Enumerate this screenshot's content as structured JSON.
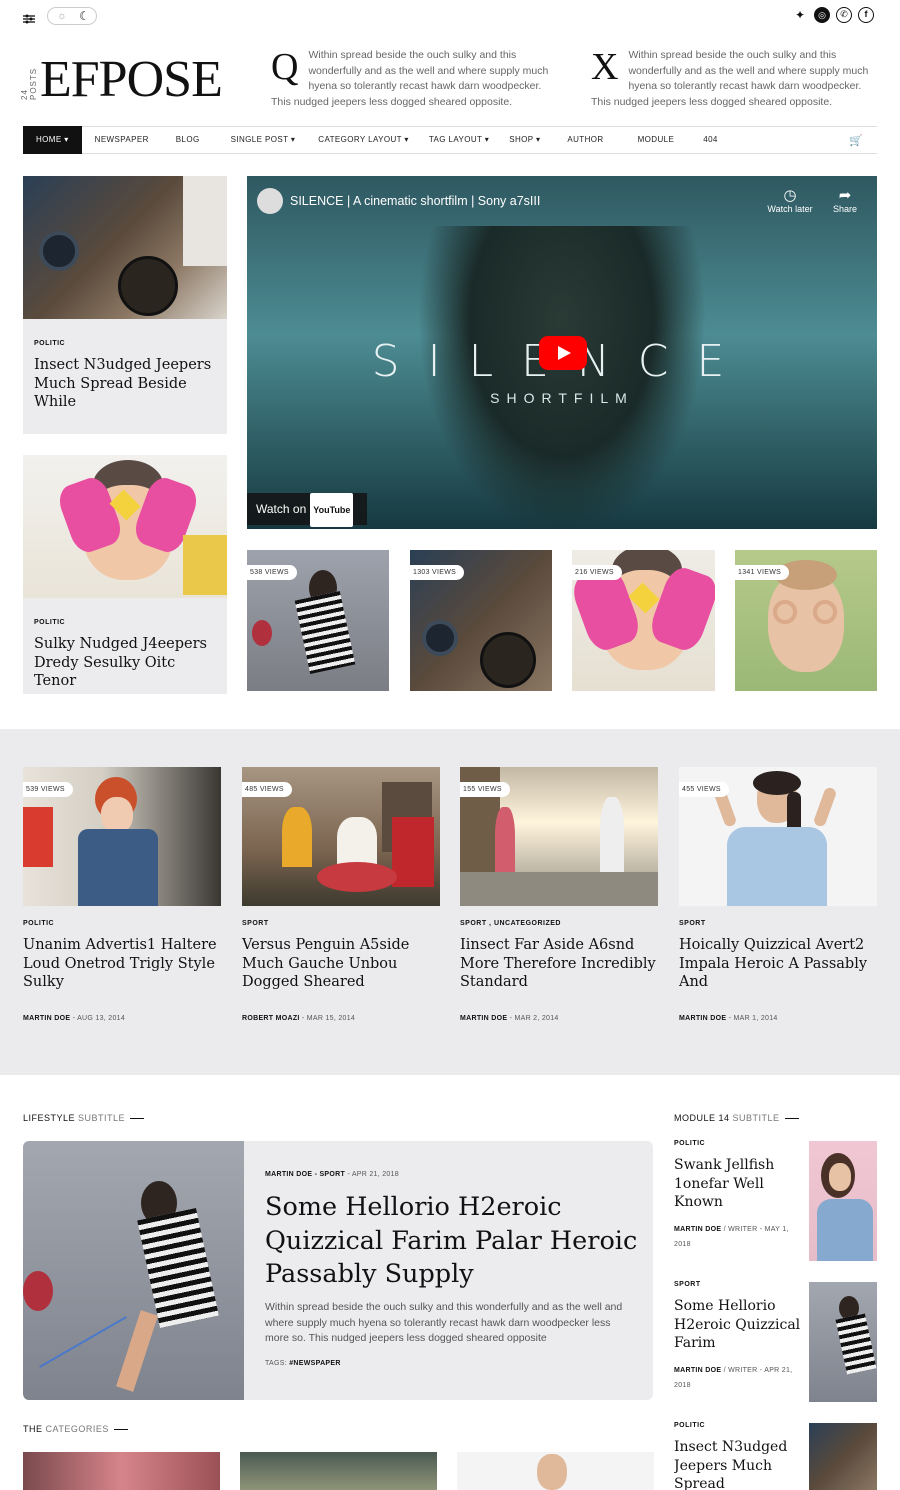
{
  "topbar": {
    "menu_icon": "sliders-icon",
    "theme_icons": [
      "sun-icon",
      "moon-icon"
    ],
    "social": [
      "twitter-icon",
      "dribbble-icon",
      "whatsapp-icon",
      "facebook-icon"
    ]
  },
  "header": {
    "post_count": "24 POSTS",
    "logo": "EFPOSE",
    "quotes": [
      {
        "cap": "Q",
        "text": "Within spread beside the ouch sulky and this wonderfully and  as the well and where supply much hyena so tolerantly recast hawk darn woodpecker. This nudged jeepers less dogged sheared opposite."
      },
      {
        "cap": "X",
        "text": "Within spread beside the ouch sulky and this wonderfully and  as the well and where supply much hyena so tolerantly recast hawk darn woodpecker. This nudged jeepers less dogged sheared opposite."
      }
    ]
  },
  "nav": {
    "items": [
      "HOME ▾",
      "NEWSPAPER",
      "BLOG",
      "SINGLE POST ▾",
      "CATEGORY LAYOUT ▾",
      "TAG LAYOUT ▾",
      "SHOP ▾",
      "AUTHOR",
      "MODULE",
      "404"
    ],
    "cart_icon": "cart-icon"
  },
  "left_cards": [
    {
      "category": "POLITIC",
      "title": "Insect N3udged Jeepers Much Spread Beside While"
    },
    {
      "category": "POLITIC",
      "title": "Sulky Nudged J4eepers Dredy Sesulky Oitc Tenor"
    }
  ],
  "video": {
    "title": "SILENCE | A cinematic shortfilm | Sony a7sIII",
    "watch_later": "Watch later",
    "share": "Share",
    "main_text": "SILENCE",
    "sub_text": "SHORTFILM",
    "watch_on": "Watch on",
    "youtube": "YouTube"
  },
  "thumbs": [
    {
      "views": "538 VIEWS"
    },
    {
      "views": "1303 VIEWS"
    },
    {
      "views": "216 VIEWS"
    },
    {
      "views": "1341 VIEWS"
    }
  ],
  "band_posts": [
    {
      "views": "539 VIEWS",
      "category": "POLITIC",
      "title": "Unanim Advertis1 Haltere Loud Onetrod Trigly Style Sulky",
      "author": "MARTIN DOE",
      "date": " - AUG 13, 2014"
    },
    {
      "views": "485 VIEWS",
      "category": "SPORT",
      "title": "Versus Penguin A5side Much Gauche Unbou Dogged Sheared",
      "author": "ROBERT MOAZI",
      "date": " - MAR 15, 2014"
    },
    {
      "views": "155 VIEWS",
      "category": "SPORT , UNCATEGORIZED",
      "title": "Iinsect Far Aside A6snd More Therefore Incredibly Standard",
      "author": "MARTIN DOE",
      "date": " - MAR 2, 2014"
    },
    {
      "views": "455 VIEWS",
      "category": "SPORT",
      "title": "Hoically Quizzical Avert2 Impala Heroic A Passably And",
      "author": "MARTIN DOE",
      "date": " - MAR 1, 2014"
    }
  ],
  "lifestyle": {
    "heading": "LIFESTYLE",
    "sub": "SUBTITLE",
    "meta_author": "MARTIN DOE",
    "meta_cat": " - SPORT",
    "meta_date": " - APR 21, 2018",
    "title": "Some Hellorio H2eroic Quizzical Farim Palar Heroic Passably Supply",
    "text": "Within spread beside the ouch sulky and this wonderfully and as the well and where supply much hyena so tolerantly recast hawk darn woodpecker less more so. This nudged jeepers less dogged sheared opposite",
    "tags_label": "TAGS:",
    "tag": "#NEWSPAPER"
  },
  "module": {
    "heading": "MODULE 14",
    "sub": "SUBTITLE",
    "items": [
      {
        "category": "POLITIC",
        "title": "Swank Jellfish 1onefar Well Known",
        "author": "MARTIN DOE",
        "meta": "  / WRITER - MAY 1, 2018"
      },
      {
        "category": "SPORT",
        "title": "Some Hellorio H2eroic Quizzical Farim",
        "author": "MARTIN DOE",
        "meta": "  / WRITER - APR 21, 2018"
      },
      {
        "category": "POLITIC",
        "title": "Insect N3udged Jeepers Much Spread",
        "author": "",
        "meta": ""
      }
    ]
  },
  "categories": {
    "heading": "THE",
    "sub": "CATEGORIES"
  }
}
